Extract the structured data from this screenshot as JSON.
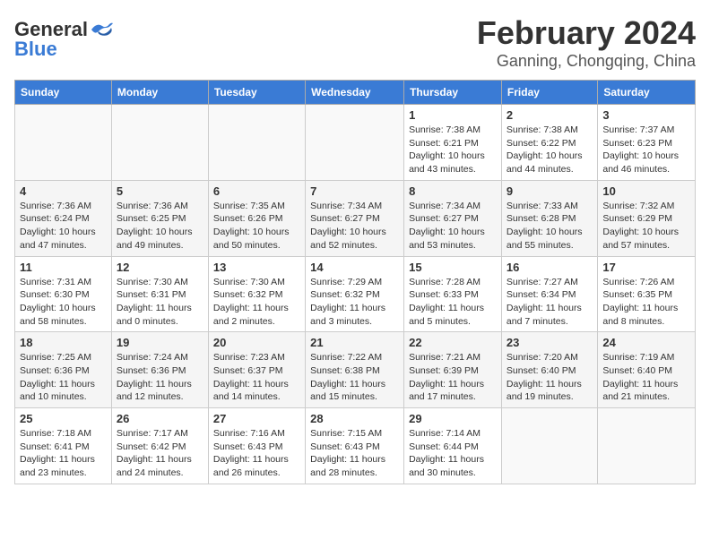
{
  "header": {
    "logo_general": "General",
    "logo_blue": "Blue",
    "month": "February 2024",
    "location": "Ganning, Chongqing, China"
  },
  "days_of_week": [
    "Sunday",
    "Monday",
    "Tuesday",
    "Wednesday",
    "Thursday",
    "Friday",
    "Saturday"
  ],
  "weeks": [
    [
      {
        "day": "",
        "detail": ""
      },
      {
        "day": "",
        "detail": ""
      },
      {
        "day": "",
        "detail": ""
      },
      {
        "day": "",
        "detail": ""
      },
      {
        "day": "1",
        "detail": "Sunrise: 7:38 AM\nSunset: 6:21 PM\nDaylight: 10 hours\nand 43 minutes."
      },
      {
        "day": "2",
        "detail": "Sunrise: 7:38 AM\nSunset: 6:22 PM\nDaylight: 10 hours\nand 44 minutes."
      },
      {
        "day": "3",
        "detail": "Sunrise: 7:37 AM\nSunset: 6:23 PM\nDaylight: 10 hours\nand 46 minutes."
      }
    ],
    [
      {
        "day": "4",
        "detail": "Sunrise: 7:36 AM\nSunset: 6:24 PM\nDaylight: 10 hours\nand 47 minutes."
      },
      {
        "day": "5",
        "detail": "Sunrise: 7:36 AM\nSunset: 6:25 PM\nDaylight: 10 hours\nand 49 minutes."
      },
      {
        "day": "6",
        "detail": "Sunrise: 7:35 AM\nSunset: 6:26 PM\nDaylight: 10 hours\nand 50 minutes."
      },
      {
        "day": "7",
        "detail": "Sunrise: 7:34 AM\nSunset: 6:27 PM\nDaylight: 10 hours\nand 52 minutes."
      },
      {
        "day": "8",
        "detail": "Sunrise: 7:34 AM\nSunset: 6:27 PM\nDaylight: 10 hours\nand 53 minutes."
      },
      {
        "day": "9",
        "detail": "Sunrise: 7:33 AM\nSunset: 6:28 PM\nDaylight: 10 hours\nand 55 minutes."
      },
      {
        "day": "10",
        "detail": "Sunrise: 7:32 AM\nSunset: 6:29 PM\nDaylight: 10 hours\nand 57 minutes."
      }
    ],
    [
      {
        "day": "11",
        "detail": "Sunrise: 7:31 AM\nSunset: 6:30 PM\nDaylight: 10 hours\nand 58 minutes."
      },
      {
        "day": "12",
        "detail": "Sunrise: 7:30 AM\nSunset: 6:31 PM\nDaylight: 11 hours\nand 0 minutes."
      },
      {
        "day": "13",
        "detail": "Sunrise: 7:30 AM\nSunset: 6:32 PM\nDaylight: 11 hours\nand 2 minutes."
      },
      {
        "day": "14",
        "detail": "Sunrise: 7:29 AM\nSunset: 6:32 PM\nDaylight: 11 hours\nand 3 minutes."
      },
      {
        "day": "15",
        "detail": "Sunrise: 7:28 AM\nSunset: 6:33 PM\nDaylight: 11 hours\nand 5 minutes."
      },
      {
        "day": "16",
        "detail": "Sunrise: 7:27 AM\nSunset: 6:34 PM\nDaylight: 11 hours\nand 7 minutes."
      },
      {
        "day": "17",
        "detail": "Sunrise: 7:26 AM\nSunset: 6:35 PM\nDaylight: 11 hours\nand 8 minutes."
      }
    ],
    [
      {
        "day": "18",
        "detail": "Sunrise: 7:25 AM\nSunset: 6:36 PM\nDaylight: 11 hours\nand 10 minutes."
      },
      {
        "day": "19",
        "detail": "Sunrise: 7:24 AM\nSunset: 6:36 PM\nDaylight: 11 hours\nand 12 minutes."
      },
      {
        "day": "20",
        "detail": "Sunrise: 7:23 AM\nSunset: 6:37 PM\nDaylight: 11 hours\nand 14 minutes."
      },
      {
        "day": "21",
        "detail": "Sunrise: 7:22 AM\nSunset: 6:38 PM\nDaylight: 11 hours\nand 15 minutes."
      },
      {
        "day": "22",
        "detail": "Sunrise: 7:21 AM\nSunset: 6:39 PM\nDaylight: 11 hours\nand 17 minutes."
      },
      {
        "day": "23",
        "detail": "Sunrise: 7:20 AM\nSunset: 6:40 PM\nDaylight: 11 hours\nand 19 minutes."
      },
      {
        "day": "24",
        "detail": "Sunrise: 7:19 AM\nSunset: 6:40 PM\nDaylight: 11 hours\nand 21 minutes."
      }
    ],
    [
      {
        "day": "25",
        "detail": "Sunrise: 7:18 AM\nSunset: 6:41 PM\nDaylight: 11 hours\nand 23 minutes."
      },
      {
        "day": "26",
        "detail": "Sunrise: 7:17 AM\nSunset: 6:42 PM\nDaylight: 11 hours\nand 24 minutes."
      },
      {
        "day": "27",
        "detail": "Sunrise: 7:16 AM\nSunset: 6:43 PM\nDaylight: 11 hours\nand 26 minutes."
      },
      {
        "day": "28",
        "detail": "Sunrise: 7:15 AM\nSunset: 6:43 PM\nDaylight: 11 hours\nand 28 minutes."
      },
      {
        "day": "29",
        "detail": "Sunrise: 7:14 AM\nSunset: 6:44 PM\nDaylight: 11 hours\nand 30 minutes."
      },
      {
        "day": "",
        "detail": ""
      },
      {
        "day": "",
        "detail": ""
      }
    ]
  ]
}
